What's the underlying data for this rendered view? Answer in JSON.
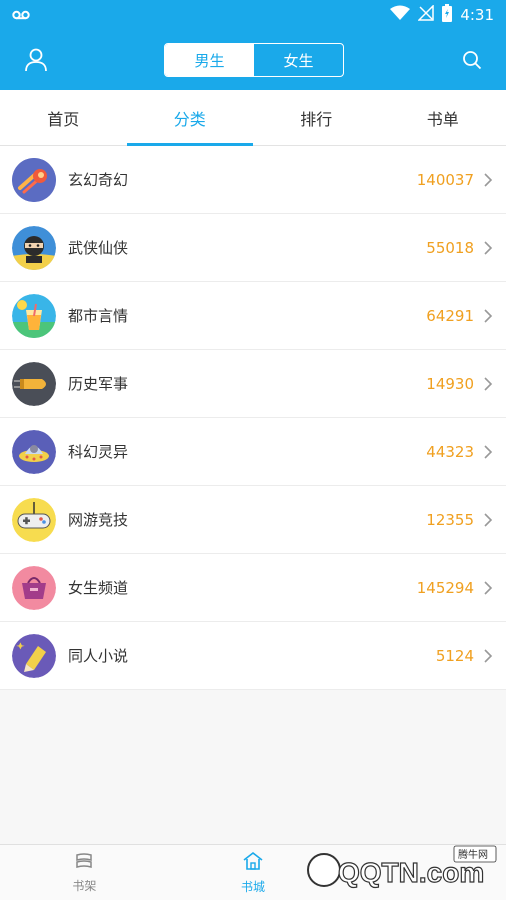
{
  "status_bar": {
    "time": "4:31"
  },
  "segment": {
    "male": "男生",
    "female": "女生"
  },
  "tabs": [
    {
      "label": "首页"
    },
    {
      "label": "分类"
    },
    {
      "label": "排行"
    },
    {
      "label": "书单"
    }
  ],
  "categories": [
    {
      "name": "玄幻奇幻",
      "count": "140037",
      "icon": "meteor-icon"
    },
    {
      "name": "武侠仙侠",
      "count": "55018",
      "icon": "ninja-icon"
    },
    {
      "name": "都市言情",
      "count": "64291",
      "icon": "drink-icon"
    },
    {
      "name": "历史军事",
      "count": "14930",
      "icon": "bullet-icon"
    },
    {
      "name": "科幻灵异",
      "count": "44323",
      "icon": "ufo-icon"
    },
    {
      "name": "网游竞技",
      "count": "12355",
      "icon": "gamepad-icon"
    },
    {
      "name": "女生频道",
      "count": "145294",
      "icon": "handbag-icon"
    },
    {
      "name": "同人小说",
      "count": "5124",
      "icon": "pencil-icon"
    }
  ],
  "bottom_nav": [
    {
      "label": "书架"
    },
    {
      "label": "书城"
    }
  ],
  "watermark": {
    "text": "QQTN.com",
    "badge": "腾牛网"
  },
  "colors": {
    "accent": "#1aa9ea",
    "count": "#f0a020"
  }
}
